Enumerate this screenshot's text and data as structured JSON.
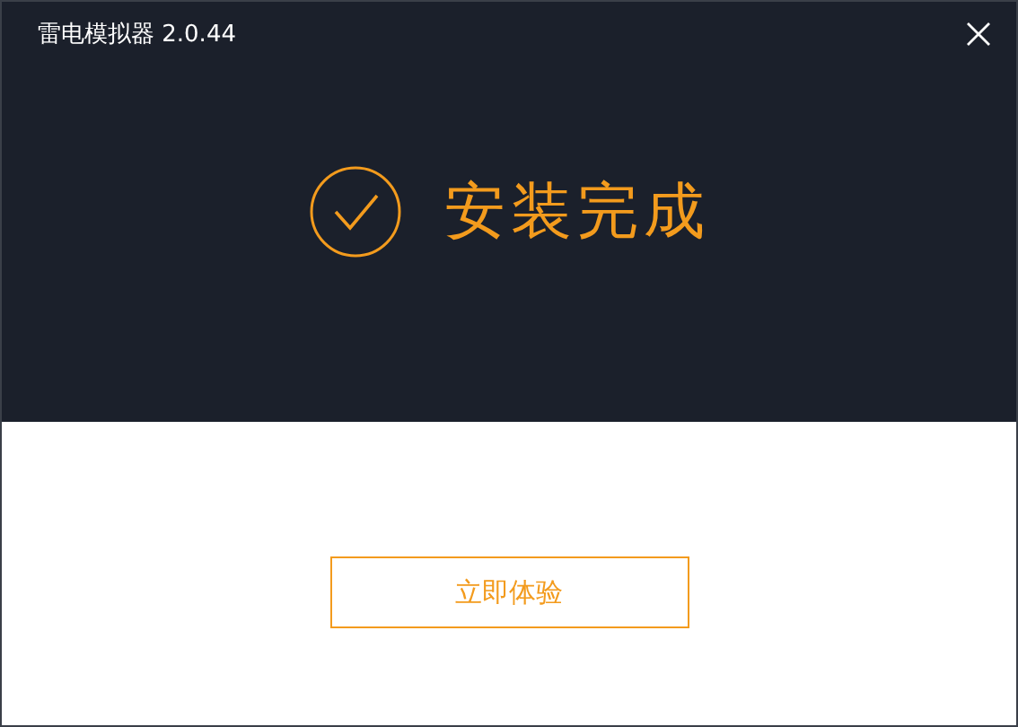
{
  "window": {
    "title": "雷电模拟器 2.0.44"
  },
  "status": {
    "message": "安装完成"
  },
  "actions": {
    "primary": "立即体验"
  }
}
